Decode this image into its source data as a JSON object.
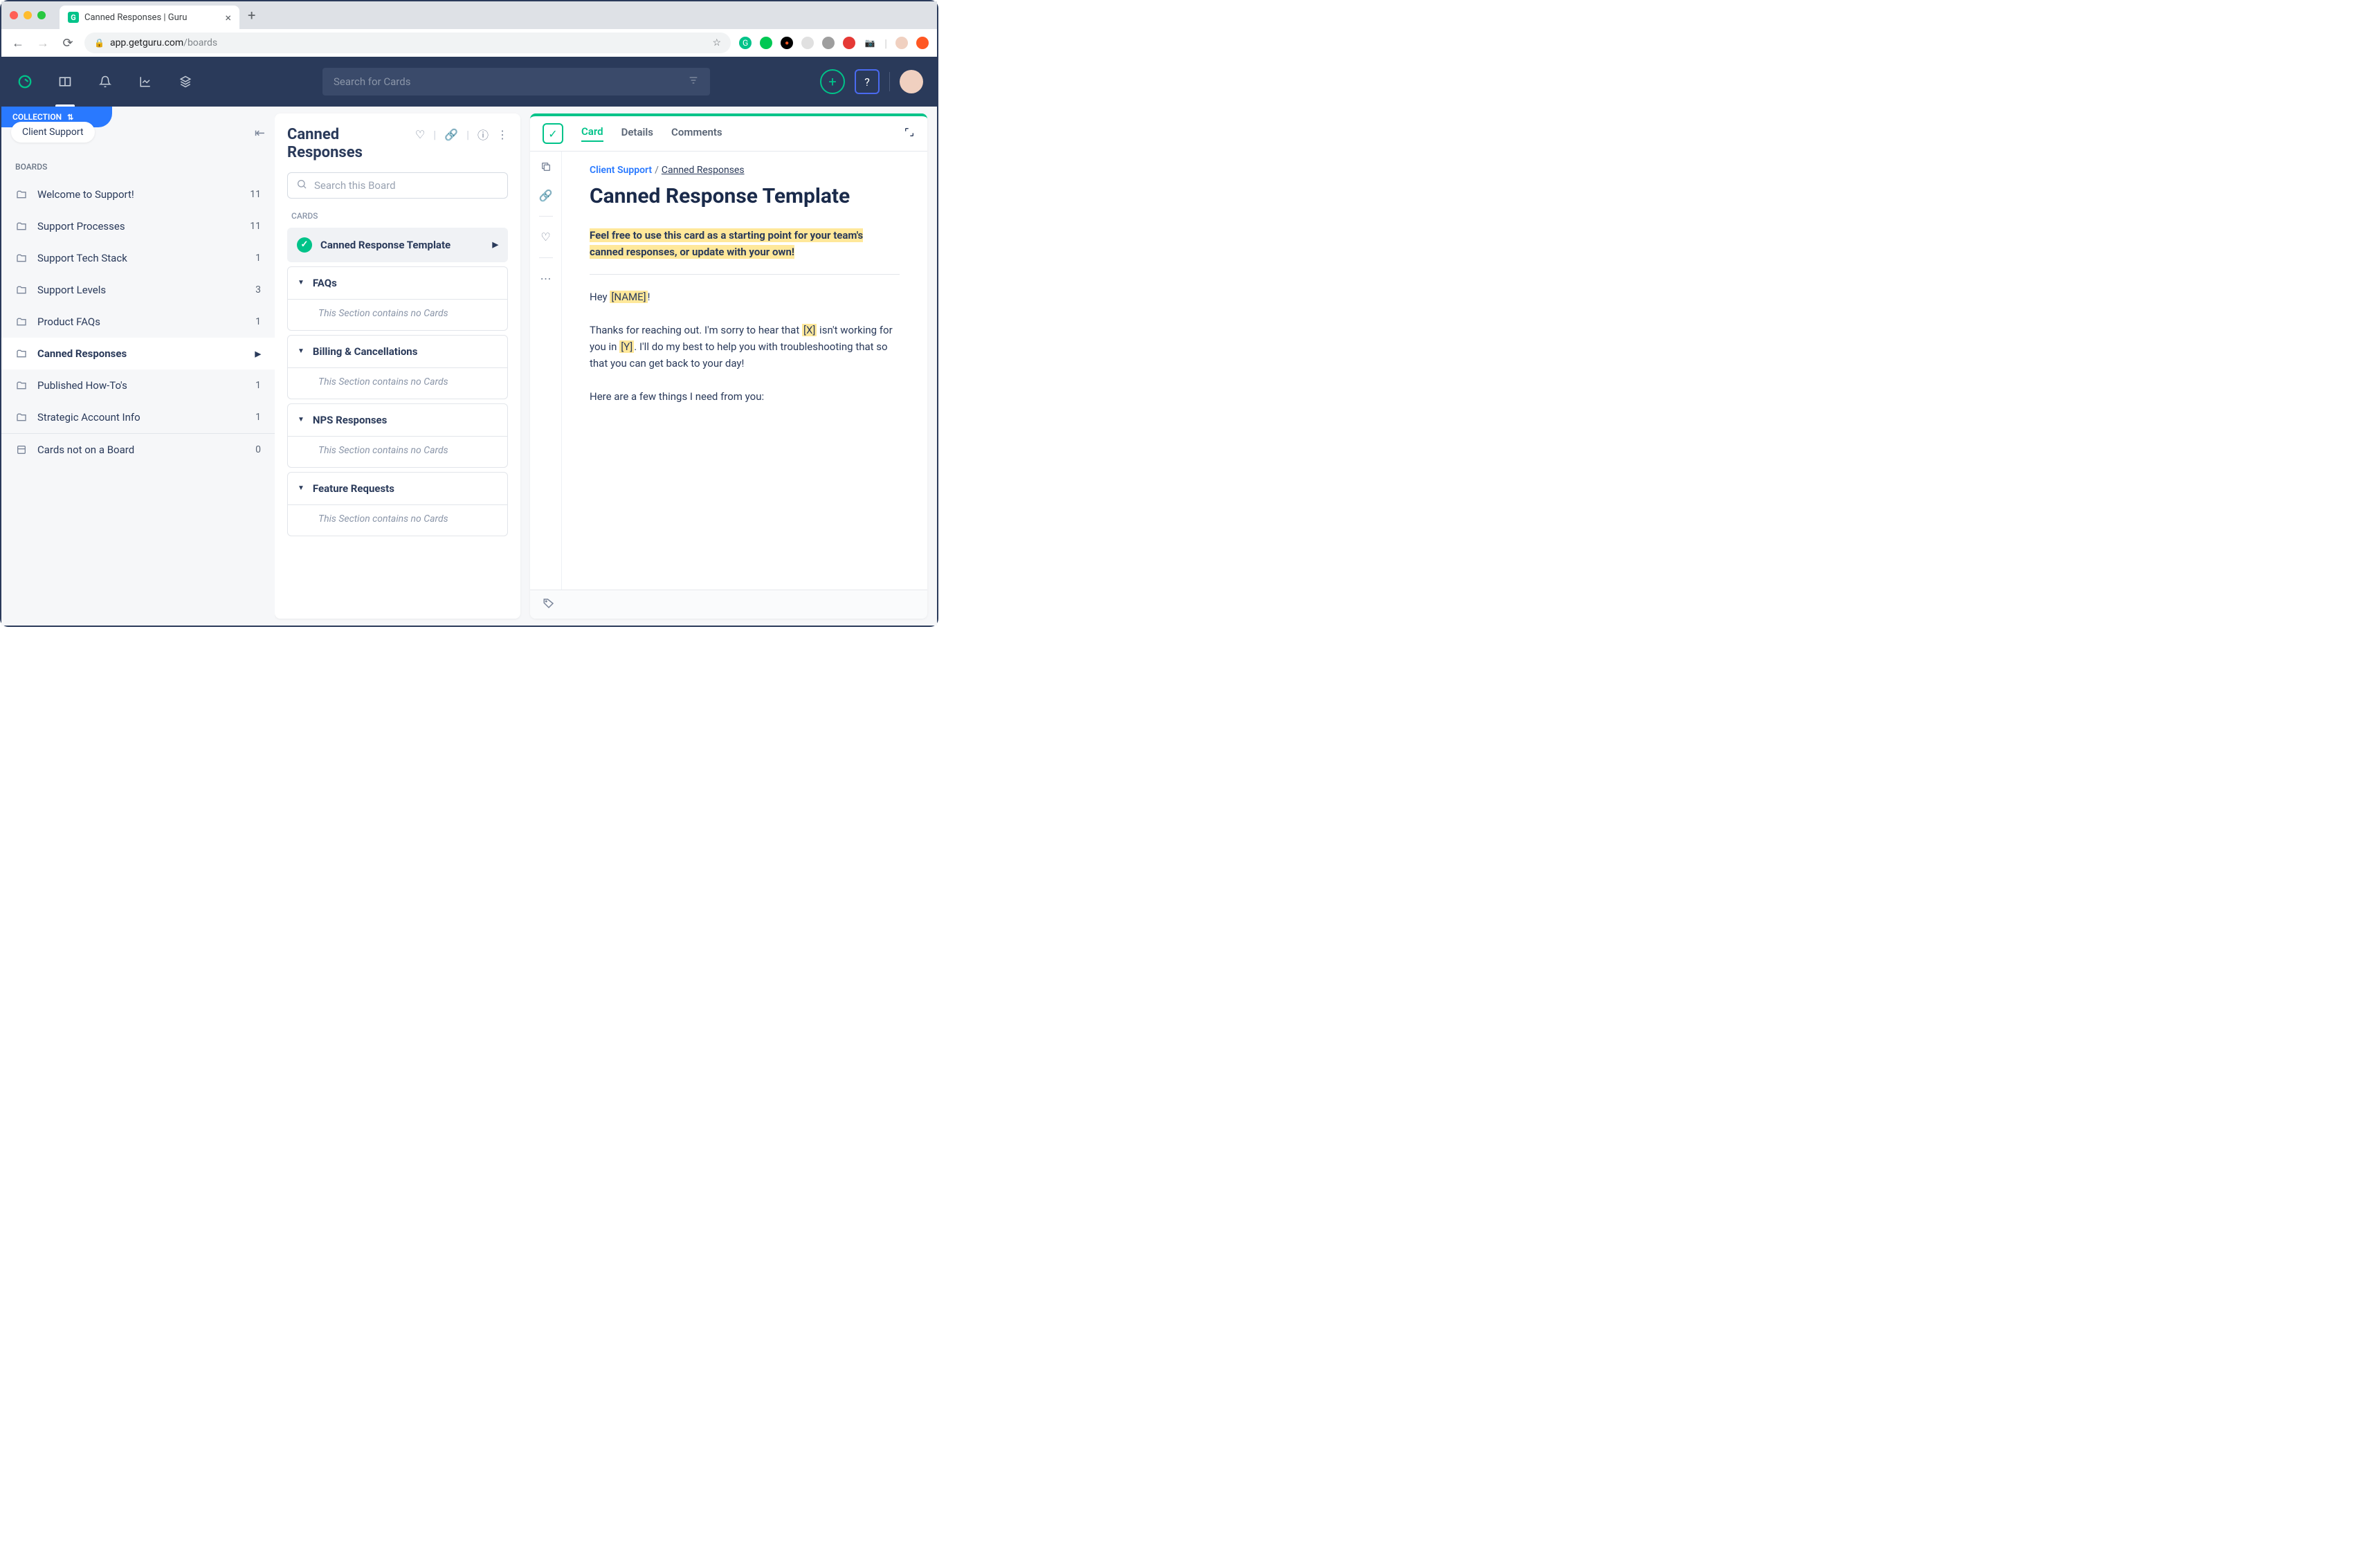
{
  "browser": {
    "tab_title": "Canned Responses | Guru",
    "url_host": "app.getguru.com",
    "url_path": "/boards"
  },
  "nav": {
    "search_placeholder": "Search for Cards"
  },
  "sidebar": {
    "collection_label": "COLLECTION",
    "collection_name": "Client Support",
    "boards_label": "BOARDS",
    "boards": [
      {
        "label": "Welcome to Support!",
        "count": "11"
      },
      {
        "label": "Support Processes",
        "count": "11"
      },
      {
        "label": "Support Tech Stack",
        "count": "1"
      },
      {
        "label": "Support Levels",
        "count": "3"
      },
      {
        "label": "Product FAQs",
        "count": "1"
      },
      {
        "label": "Canned Responses",
        "count": ""
      },
      {
        "label": "Published How-To's",
        "count": "1"
      },
      {
        "label": "Strategic Account Info",
        "count": "1"
      }
    ],
    "not_on_board": {
      "label": "Cards not on a Board",
      "count": "0"
    }
  },
  "board_panel": {
    "title": "Canned Responses",
    "search_placeholder": "Search this Board",
    "cards_label": "CARDS",
    "selected_card": "Canned Response Template",
    "sections": [
      {
        "label": "FAQs",
        "empty": "This Section contains no Cards"
      },
      {
        "label": "Billing & Cancellations",
        "empty": "This Section contains no Cards"
      },
      {
        "label": "NPS Responses",
        "empty": "This Section contains no Cards"
      },
      {
        "label": "Feature Requests",
        "empty": "This Section contains no Cards"
      }
    ]
  },
  "card": {
    "tabs": {
      "card": "Card",
      "details": "Details",
      "comments": "Comments"
    },
    "breadcrumb": {
      "collection": "Client Support",
      "board": "Canned Responses"
    },
    "title": "Canned Response Template",
    "intro": "Feel free to use this card as a starting point for your team's canned responses, or update with your own!",
    "body": {
      "l1a": "Hey ",
      "l1b": "[NAME]",
      "l1c": "!",
      "l2a": "Thanks for reaching out. I'm sorry to hear that ",
      "l2b": "[X]",
      "l2c": " isn't working for you in ",
      "l2d": "[Y]",
      "l2e": ". I'll do my best to help you with troubleshooting that so that you can get back to your day!",
      "l3": "Here are a few things I need from you:"
    }
  }
}
